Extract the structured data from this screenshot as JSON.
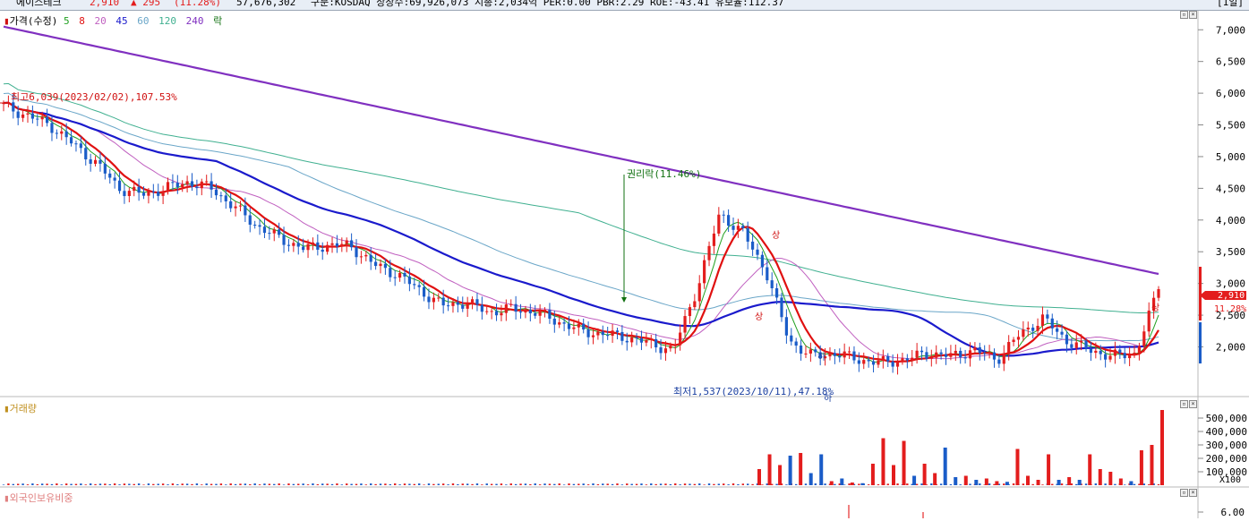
{
  "header": {
    "stock_name": "에이스테크",
    "price": "2,910",
    "change": "▲ 295",
    "change_pct": "(11.28%)",
    "volume": "57,676,302",
    "info": "구분:KOSDAQ 상장수:69,926,073 시총:2,034억 PER:0.00 PBR:2.29 ROE:-43.41 유보율:112.37",
    "period_label": "[1일]"
  },
  "colors": {
    "up": "#e31d1d",
    "down": "#1a5cc8",
    "ma5": "#20a020",
    "ma8": "#e01010",
    "ma20": "#c060c0",
    "ma45": "#1a1acc",
    "ma60": "#6aa6c8",
    "ma120": "#40b090",
    "ma240": "#8030c0"
  },
  "price_legend": {
    "price_label": "가격(수정)",
    "ma": [
      "5",
      "8",
      "20",
      "45",
      "60",
      "120",
      "240"
    ],
    "rights_label": "락"
  },
  "annotations": {
    "high": "최고6,039(2023/02/02),107.53%",
    "low": "최저1,537(2023/10/11),47.18%",
    "rights": "권리락(11.46%)",
    "upper_limit": "상",
    "lower_limit": "하"
  },
  "volume_legend": "거래량",
  "foreign_legend": "외국인보유비중",
  "last_price_label": "2,910",
  "last_change_label": "11.28%",
  "chart_data": [
    {
      "type": "candlestick",
      "title": "가격(수정)",
      "yticks": [
        2000,
        2500,
        3000,
        3500,
        4000,
        4500,
        5000,
        5500,
        6000,
        6500,
        7000
      ],
      "ytick_labels": [
        "2,000",
        "2,500",
        "3,000",
        "3,500",
        "4,000",
        "4,500",
        "5,000",
        "5,500",
        "6,000",
        "6,500",
        "7,000"
      ],
      "ylim": [
        1400,
        7300
      ],
      "series_close_approx": [
        5800,
        5650,
        5500,
        5200,
        4900,
        4500,
        4400,
        4500,
        4600,
        4500,
        4200,
        3900,
        3700,
        3550,
        3600,
        3600,
        3300,
        3150,
        2900,
        2650,
        2700,
        2550,
        2600,
        2550,
        2400,
        2250,
        2200,
        2150,
        2050,
        1950,
        2900,
        4100,
        3800,
        3200,
        2100,
        1850,
        1900,
        1800,
        1750,
        1800,
        1900,
        1850,
        1950,
        1800,
        2200,
        2450,
        2100,
        1950,
        1850,
        1900,
        2910
      ],
      "high": 6039,
      "low": 1537,
      "last": 2910
    },
    {
      "type": "bar",
      "title": "거래량",
      "yticks": [
        100000,
        200000,
        300000,
        400000,
        500000
      ],
      "ytick_labels": [
        "100,000",
        "200,000",
        "300,000",
        "400,000",
        "500,000"
      ],
      "ylim": [
        0,
        600000
      ],
      "unit": "X100",
      "values": [
        {
          "dir": "up",
          "v": 120000
        },
        {
          "dir": "up",
          "v": 230000
        },
        {
          "dir": "up",
          "v": 150000
        },
        {
          "dir": "down",
          "v": 220000
        },
        {
          "dir": "up",
          "v": 240000
        },
        {
          "dir": "down",
          "v": 90000
        },
        {
          "dir": "down",
          "v": 230000
        },
        {
          "dir": "up",
          "v": 30000
        },
        {
          "dir": "down",
          "v": 50000
        },
        {
          "dir": "up",
          "v": 20000
        },
        {
          "dir": "down",
          "v": 15000
        },
        {
          "dir": "up",
          "v": 160000
        },
        {
          "dir": "up",
          "v": 350000
        },
        {
          "dir": "up",
          "v": 150000
        },
        {
          "dir": "up",
          "v": 330000
        },
        {
          "dir": "down",
          "v": 70000
        },
        {
          "dir": "up",
          "v": 160000
        },
        {
          "dir": "up",
          "v": 90000
        },
        {
          "dir": "down",
          "v": 280000
        },
        {
          "dir": "down",
          "v": 60000
        },
        {
          "dir": "up",
          "v": 70000
        },
        {
          "dir": "down",
          "v": 40000
        },
        {
          "dir": "up",
          "v": 50000
        },
        {
          "dir": "up",
          "v": 30000
        },
        {
          "dir": "down",
          "v": 25000
        },
        {
          "dir": "up",
          "v": 270000
        },
        {
          "dir": "up",
          "v": 70000
        },
        {
          "dir": "up",
          "v": 40000
        },
        {
          "dir": "up",
          "v": 230000
        },
        {
          "dir": "down",
          "v": 40000
        },
        {
          "dir": "up",
          "v": 60000
        },
        {
          "dir": "down",
          "v": 40000
        },
        {
          "dir": "up",
          "v": 230000
        },
        {
          "dir": "up",
          "v": 120000
        },
        {
          "dir": "up",
          "v": 100000
        },
        {
          "dir": "up",
          "v": 50000
        },
        {
          "dir": "down",
          "v": 30000
        },
        {
          "dir": "up",
          "v": 260000
        },
        {
          "dir": "up",
          "v": 300000
        },
        {
          "dir": "up",
          "v": 560000
        }
      ]
    },
    {
      "type": "line",
      "title": "외국인보유비중",
      "yticks": [
        6.0
      ],
      "ytick_labels": [
        "6.00"
      ]
    }
  ]
}
